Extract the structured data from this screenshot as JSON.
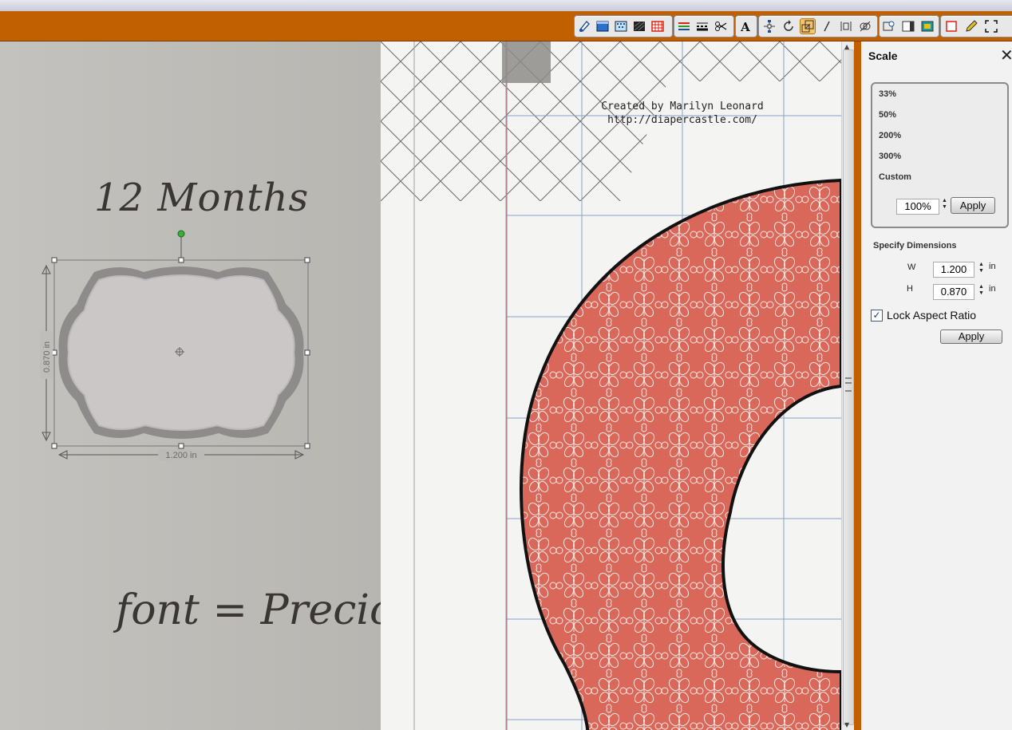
{
  "toolbar": {
    "icons": [
      "shape-tool-icon",
      "fill-icon",
      "pattern-icon",
      "texture-icon",
      "grid-icon",
      "line-color-icon",
      "line-style-icon",
      "scissors-icon",
      "text-icon",
      "node-edit-icon",
      "rotate-icon",
      "scale-icon",
      "slant-icon",
      "align-icon",
      "weld-icon",
      "view-icon",
      "panel-icon",
      "color-icon",
      "frame-icon",
      "pencil-icon",
      "fullscreen-icon"
    ],
    "active_icon": "scale-icon",
    "accent_color": "#c06000"
  },
  "canvas": {
    "title_text": "12 Months",
    "font_text": "font = Precious",
    "width_label": "1.200 in",
    "height_label": "0.870 in",
    "credit_line1": "Created by Marilyn Leonard",
    "credit_line2": "http://diapercastle.com/",
    "ring_color": "#d9685a"
  },
  "panel": {
    "title": "Scale",
    "close_icon": "close-icon",
    "presets": [
      "33%",
      "50%",
      "200%",
      "300%",
      "Custom"
    ],
    "custom_value": "100%",
    "apply_label": "Apply",
    "dimensions_heading": "Specify Dimensions",
    "w_label": "W",
    "h_label": "H",
    "w_value": "1.200",
    "h_value": "0.870",
    "unit": "in",
    "lock_label": "Lock Aspect Ratio",
    "lock_checked": true,
    "apply2_label": "Apply"
  }
}
